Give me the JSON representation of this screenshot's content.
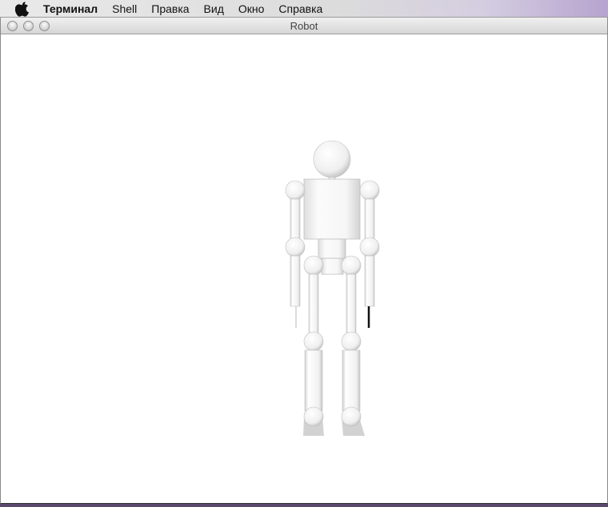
{
  "menubar": {
    "apple_icon": "apple-logo-icon",
    "app_name": "Терминал",
    "items": [
      "Shell",
      "Правка",
      "Вид",
      "Окно",
      "Справка"
    ]
  },
  "window": {
    "title": "Robot",
    "controls": [
      "close-button",
      "minimize-button",
      "zoom-button"
    ]
  },
  "scene": {
    "background": "#ffffff",
    "model_color": "#f4f4f4",
    "shadow_color": "#cfcfcf"
  }
}
